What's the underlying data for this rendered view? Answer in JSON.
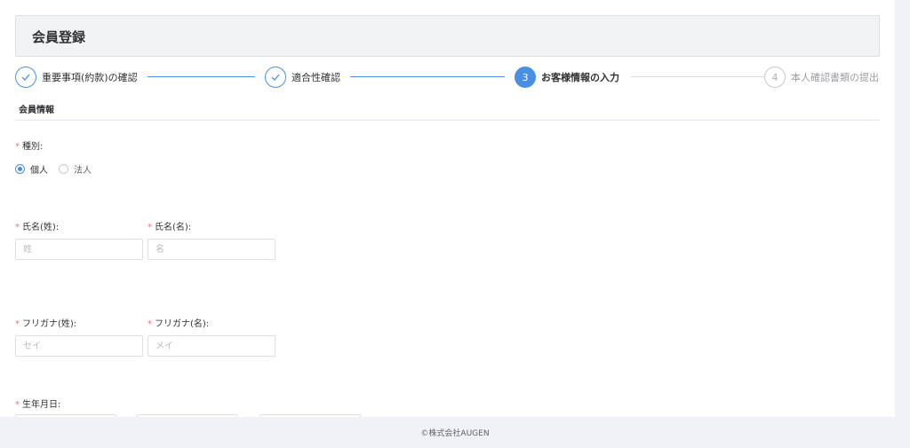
{
  "header": {
    "title": "会員登録"
  },
  "steps": [
    {
      "number": "1",
      "label": "重要事項(約款)の確認",
      "status": "done",
      "icon": "check-icon"
    },
    {
      "number": "2",
      "label": "適合性確認",
      "status": "done",
      "icon": "check-icon"
    },
    {
      "number": "3",
      "label": "お客様情報の入力",
      "status": "active"
    },
    {
      "number": "4",
      "label": "本人確認書類の提出",
      "status": "todo"
    }
  ],
  "section": {
    "title": "会員情報"
  },
  "form": {
    "type": {
      "label": "種別:",
      "options": [
        "個人",
        "法人"
      ],
      "selected": "個人"
    },
    "last_name": {
      "label": "氏名(姓):",
      "placeholder": "姓",
      "value": ""
    },
    "first_name": {
      "label": "氏名(名):",
      "placeholder": "名",
      "value": ""
    },
    "last_name_kana": {
      "label": "フリガナ(姓):",
      "placeholder": "セイ",
      "value": ""
    },
    "first_name_kana": {
      "label": "フリガナ(名):",
      "placeholder": "メイ",
      "value": ""
    },
    "birthdate": {
      "label": "生年月日:"
    },
    "required_mark": "*"
  },
  "footer": {
    "copyright": "©株式会社AUGEN"
  },
  "colors": {
    "accent": "#4a90e2",
    "required": "#f56c6c"
  }
}
